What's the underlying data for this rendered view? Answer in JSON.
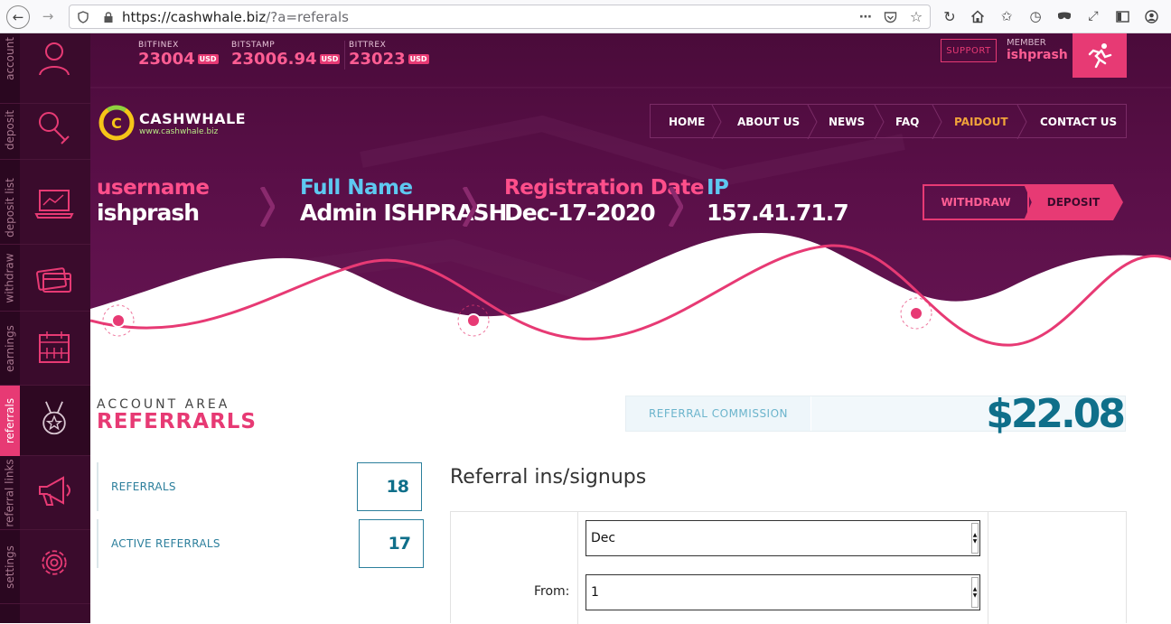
{
  "browser": {
    "url_host": "https://cashwhale.biz",
    "url_path": "/?a=referals"
  },
  "sidebar": {
    "items": [
      {
        "label": "account",
        "icon": "user-icon"
      },
      {
        "label": "deposit",
        "icon": "money-bag-icon"
      },
      {
        "label": "deposit list",
        "icon": "laptop-chart-icon"
      },
      {
        "label": "withdraw",
        "icon": "cards-icon"
      },
      {
        "label": "earnings",
        "icon": "calendar-icon"
      },
      {
        "label": "referrals",
        "icon": "medal-icon",
        "active": true
      },
      {
        "label": "referral links",
        "icon": "megaphone-icon"
      },
      {
        "label": "settings",
        "icon": "gear-icon"
      }
    ]
  },
  "tickers": [
    {
      "name": "BITFINEX",
      "value": "23004",
      "unit": "USD"
    },
    {
      "name": "BITSTAMP",
      "value": "23006.94",
      "unit": "USD"
    },
    {
      "name": "BITTREX",
      "value": "23023",
      "unit": "USD"
    }
  ],
  "header": {
    "support": "SUPPORT",
    "member_label": "MEMBER",
    "member_name": "ishprash"
  },
  "logo": {
    "name": "CASHWHALE",
    "url": "www.cashwhale.biz"
  },
  "nav": [
    "HOME",
    "ABOUT US",
    "NEWS",
    "FAQ",
    "PAIDOUT",
    "CONTACT US"
  ],
  "info": {
    "username_label": "username",
    "username": "ishprash",
    "fullname_label": "Full Name",
    "fullname": "Admin ISHPRASH",
    "regdate_label": "Registration Date",
    "regdate": "Dec-17-2020",
    "ip_label": "IP",
    "ip": "157.41.71.7"
  },
  "buttons": {
    "withdraw": "WITHDRAW",
    "deposit": "DEPOSIT"
  },
  "area": {
    "title": "ACCOUNT AREA",
    "heading": "REFERRARLS"
  },
  "commission": {
    "label": "REFERRAL COMMISSION",
    "value": "$22.08"
  },
  "stats": [
    {
      "label": "REFERRALS",
      "value": "18"
    },
    {
      "label": "ACTIVE REFERRALS",
      "value": "17"
    }
  ],
  "referrals": {
    "title": "Referral ins/signups",
    "month": "Dec",
    "from_label": "From:",
    "from_day": "1"
  },
  "colors": {
    "accent": "#e73a74",
    "teal": "#0f6f8a"
  }
}
